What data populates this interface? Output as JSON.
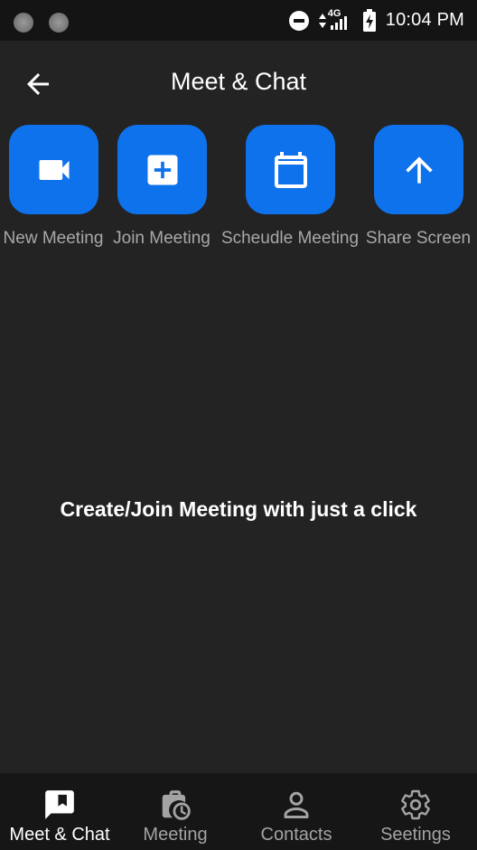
{
  "status_bar": {
    "network": "4G",
    "time": "10:04 PM"
  },
  "app_bar": {
    "title": "Meet & Chat",
    "back_icon": "arrow-left-icon"
  },
  "actions": [
    {
      "label": "New Meeting",
      "icon": "video-camera-icon"
    },
    {
      "label": "Join Meeting",
      "icon": "plus-box-icon"
    },
    {
      "label": "Scheudle Meeting",
      "icon": "calendar-icon"
    },
    {
      "label": "Share Screen",
      "icon": "arrow-up-icon"
    }
  ],
  "main": {
    "message": "Create/Join Meeting with just a click"
  },
  "bottom_nav": [
    {
      "label": "Meet & Chat",
      "icon": "chat-bookmark-icon",
      "active": true
    },
    {
      "label": "Meeting",
      "icon": "bag-clock-icon",
      "active": false
    },
    {
      "label": "Contacts",
      "icon": "person-icon",
      "active": false
    },
    {
      "label": "Seetings",
      "icon": "gear-icon",
      "active": false
    }
  ],
  "colors": {
    "background": "#232323",
    "status_bar": "#141414",
    "accent": "#0e72ed",
    "bottom_nav": "#161616",
    "muted_text": "#a8a8a8"
  }
}
